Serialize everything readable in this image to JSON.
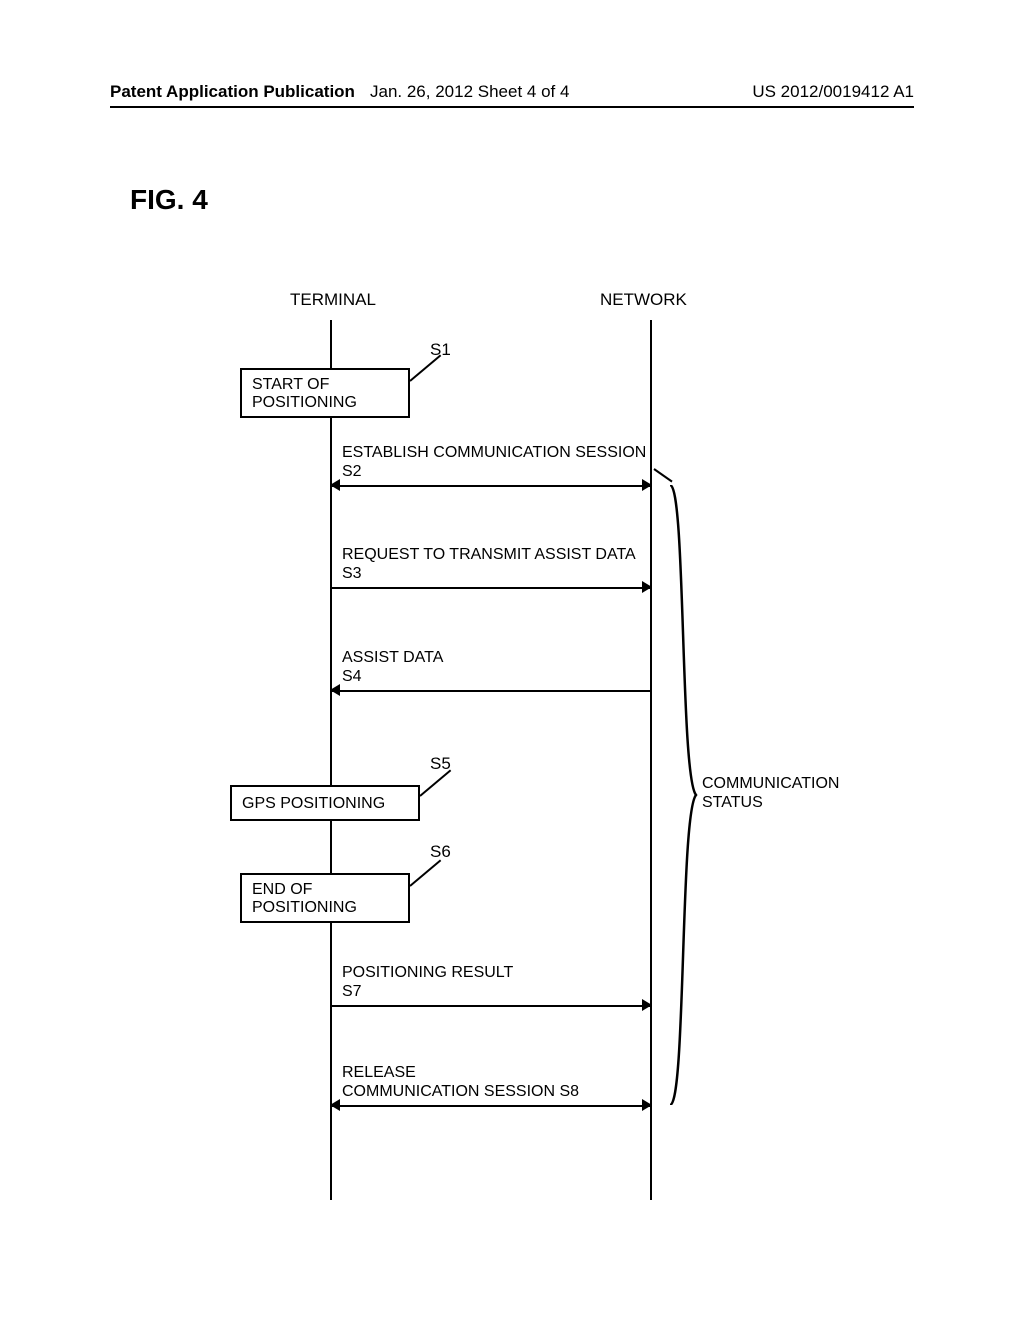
{
  "header": {
    "left": "Patent Application Publication",
    "mid": "Jan. 26, 2012  Sheet 4 of 4",
    "right": "US 2012/0019412 A1"
  },
  "figure": {
    "label": "FIG. 4",
    "terminal": "TERMINAL",
    "network": "NETWORK",
    "brace_label": "COMMUNICATION\nSTATUS"
  },
  "steps": {
    "s1": {
      "id": "S1",
      "text": "START OF\nPOSITIONING"
    },
    "s2": {
      "id": "S2",
      "text": "ESTABLISH COMMUNICATION SESSION\nS2"
    },
    "s3": {
      "id": "S3",
      "text": "REQUEST TO TRANSMIT ASSIST DATA\nS3"
    },
    "s4": {
      "id": "S4",
      "text": "ASSIST DATA\nS4"
    },
    "s5": {
      "id": "S5",
      "text": "GPS POSITIONING"
    },
    "s6": {
      "id": "S6",
      "text": "END OF\nPOSITIONING"
    },
    "s7": {
      "id": "S7",
      "text": "POSITIONING RESULT\nS7"
    },
    "s8": {
      "id": "S8",
      "text": "RELEASE\nCOMMUNICATION SESSION  S8"
    }
  },
  "chart_data": {
    "type": "sequence",
    "title": "FIG. 4",
    "participants": [
      "TERMINAL",
      "NETWORK"
    ],
    "events": [
      {
        "step": "S1",
        "at": "TERMINAL",
        "kind": "action",
        "label": "START OF POSITIONING"
      },
      {
        "step": "S2",
        "from": "TERMINAL",
        "to": "NETWORK",
        "kind": "bidir",
        "label": "ESTABLISH COMMUNICATION SESSION"
      },
      {
        "step": "S3",
        "from": "TERMINAL",
        "to": "NETWORK",
        "kind": "message",
        "label": "REQUEST TO TRANSMIT ASSIST DATA"
      },
      {
        "step": "S4",
        "from": "NETWORK",
        "to": "TERMINAL",
        "kind": "message",
        "label": "ASSIST DATA"
      },
      {
        "step": "S5",
        "at": "TERMINAL",
        "kind": "action",
        "label": "GPS POSITIONING"
      },
      {
        "step": "S6",
        "at": "TERMINAL",
        "kind": "action",
        "label": "END OF POSITIONING"
      },
      {
        "step": "S7",
        "from": "TERMINAL",
        "to": "NETWORK",
        "kind": "message",
        "label": "POSITIONING RESULT"
      },
      {
        "step": "S8",
        "from": "TERMINAL",
        "to": "NETWORK",
        "kind": "bidir",
        "label": "RELEASE COMMUNICATION SESSION"
      }
    ],
    "span": {
      "label": "COMMUNICATION STATUS",
      "from_step": "S2",
      "to_step": "S8",
      "on": "NETWORK"
    }
  }
}
